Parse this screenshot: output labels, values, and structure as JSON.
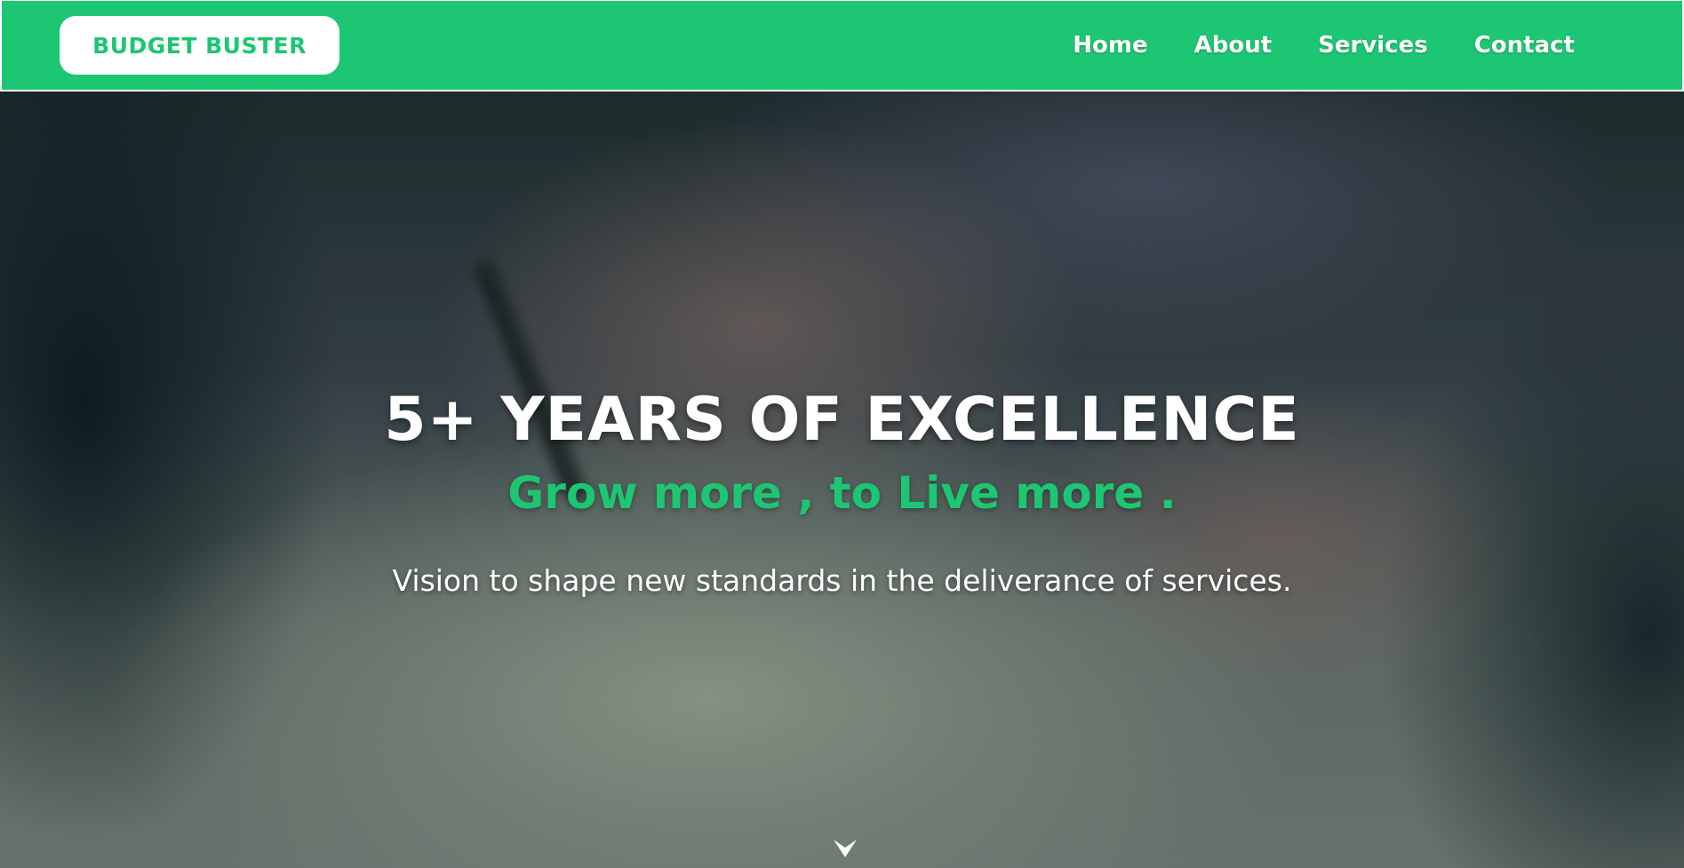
{
  "navbar": {
    "brand": "BUDGET BUSTER",
    "links": [
      {
        "label": "Home"
      },
      {
        "label": "About"
      },
      {
        "label": "Services"
      },
      {
        "label": "Contact"
      }
    ]
  },
  "hero": {
    "title": "5+ YEARS OF EXCELLENCE",
    "subtitle": "Grow more , to Live more .",
    "text": "Vision to shape new standards in the deliverance of services.",
    "scroll_icon": "chevron-down-icon"
  },
  "colors": {
    "accent": "#1dc673",
    "text_light": "#ffffff"
  }
}
